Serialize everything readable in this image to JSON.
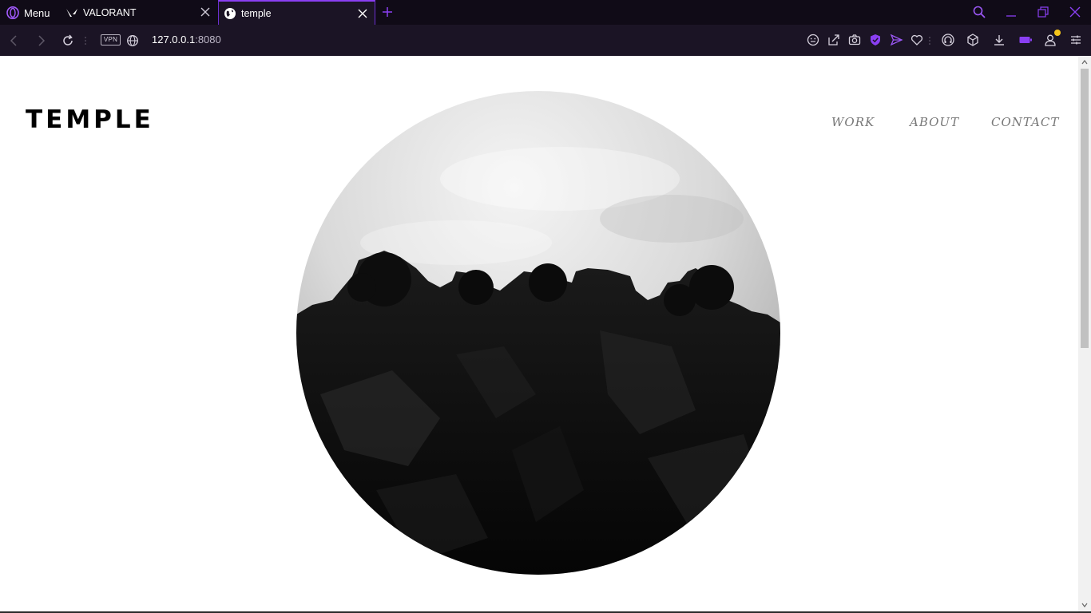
{
  "browser": {
    "menu_label": "Menu",
    "tabs": [
      {
        "title": "VALORANT",
        "icon": "valorant-icon",
        "active": false
      },
      {
        "title": "temple",
        "icon": "globe-icon",
        "active": true
      }
    ],
    "url_host": "127.0.0.1",
    "url_port": ":8080",
    "vpn_label": "VPN",
    "accent_color": "#8a3ff2",
    "notify_color": "#f6c51a"
  },
  "site": {
    "logo": "TEMPLE",
    "nav": {
      "work": "WORK",
      "about": "ABOUT",
      "contact": "CONTACT"
    },
    "hero_image": "black-and-white-rocky-hill-photo"
  }
}
